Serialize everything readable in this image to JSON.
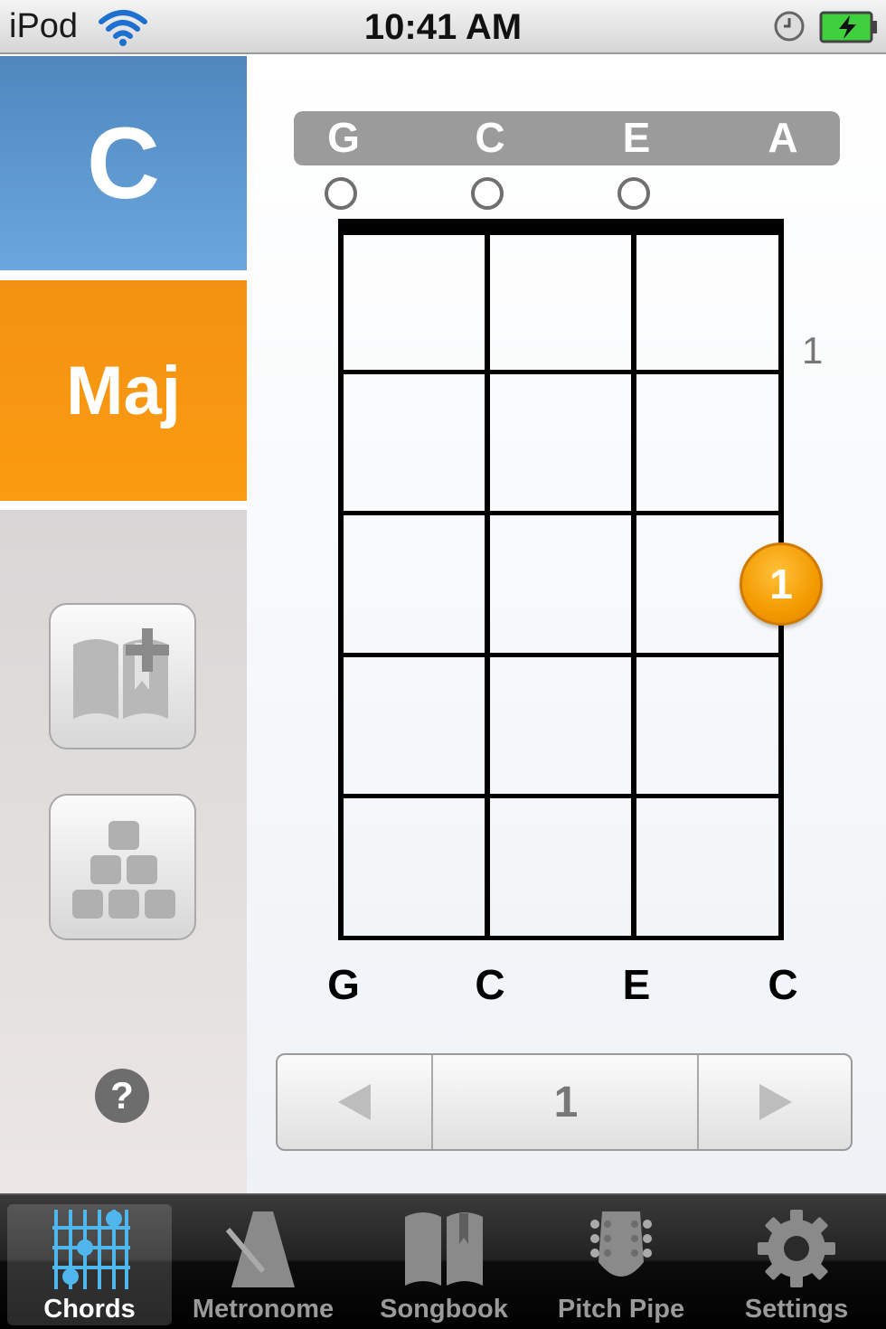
{
  "status_bar": {
    "carrier": "iPod",
    "time": "10:41 AM"
  },
  "chord": {
    "root": "C",
    "quality": "Maj"
  },
  "tuning": [
    "G",
    "C",
    "E",
    "A"
  ],
  "notes": [
    "G",
    "C",
    "E",
    "C"
  ],
  "fret_start": "1",
  "finger": {
    "label": "1",
    "string_index": 3,
    "fret": 3
  },
  "pager": {
    "value": "1"
  },
  "help": {
    "label": "?"
  },
  "tabs": [
    {
      "label": "Chords",
      "icon": "chords-icon",
      "active": true
    },
    {
      "label": "Metronome",
      "icon": "metronome-icon",
      "active": false
    },
    {
      "label": "Songbook",
      "icon": "songbook-icon",
      "active": false
    },
    {
      "label": "Pitch Pipe",
      "icon": "pitch-pipe-icon",
      "active": false
    },
    {
      "label": "Settings",
      "icon": "settings-icon",
      "active": false
    }
  ],
  "colors": {
    "root_tile": "#5b96cf",
    "quality_tile": "#f7950f",
    "finger_dot": "#f39a00",
    "active_tab_icon": "#4fb6ee"
  }
}
